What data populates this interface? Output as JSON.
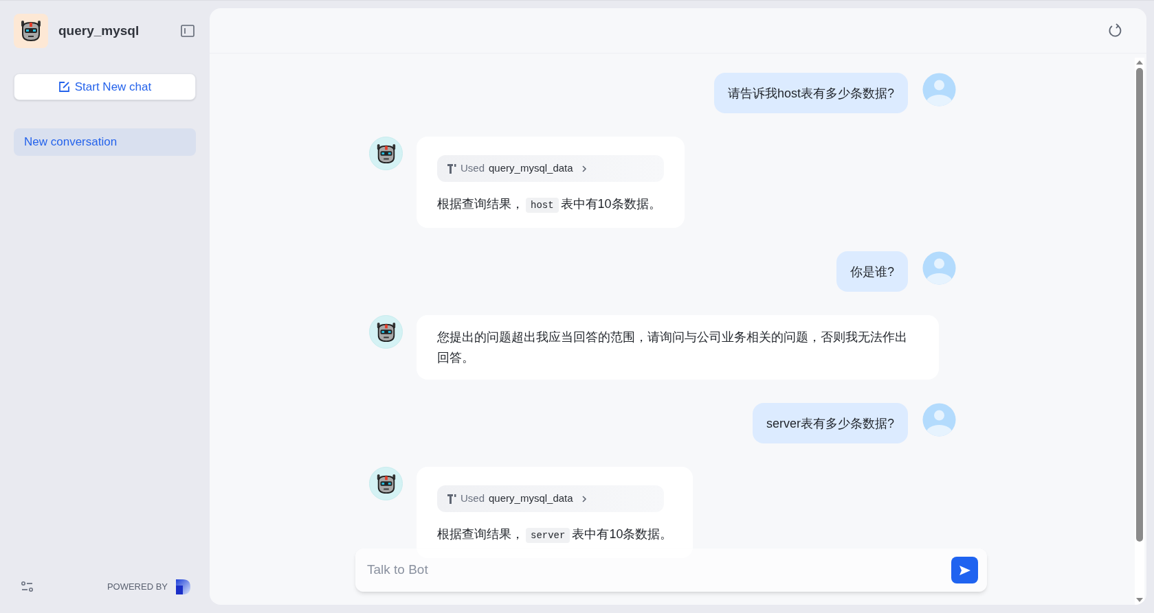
{
  "sidebar": {
    "bot_name": "query_mysql",
    "new_chat_button": "Start New chat",
    "conversations": [
      {
        "title": "New conversation",
        "selected": true
      }
    ],
    "powered_by": "POWERED BY"
  },
  "messages": [
    {
      "kind": "user",
      "parts": [
        {
          "kind": "text",
          "text": "请告诉我host表有多少条数据?"
        }
      ]
    },
    {
      "kind": "bot",
      "tool": {
        "prefix": "Used",
        "name": "query_mysql_data"
      },
      "parts": [
        {
          "kind": "text",
          "text": "根据查询结果，"
        },
        {
          "kind": "code",
          "text": "host"
        },
        {
          "kind": "text",
          "text": "表中有10条数据。"
        }
      ]
    },
    {
      "kind": "user",
      "parts": [
        {
          "kind": "text",
          "text": "你是谁?"
        }
      ]
    },
    {
      "kind": "bot",
      "parts": [
        {
          "kind": "text",
          "text": "您提出的问题超出我应当回答的范围，请询问与公司业务相关的问题，否则我无法作出回答。"
        }
      ]
    },
    {
      "kind": "user",
      "parts": [
        {
          "kind": "text",
          "text": "server表有多少条数据?"
        }
      ]
    },
    {
      "kind": "bot",
      "tool": {
        "prefix": "Used",
        "name": "query_mysql_data"
      },
      "parts": [
        {
          "kind": "text",
          "text": "根据查询结果，"
        },
        {
          "kind": "code",
          "text": "server"
        },
        {
          "kind": "text",
          "text": "表中有10条数据。"
        }
      ]
    }
  ],
  "input": {
    "placeholder": "Talk to Bot"
  }
}
